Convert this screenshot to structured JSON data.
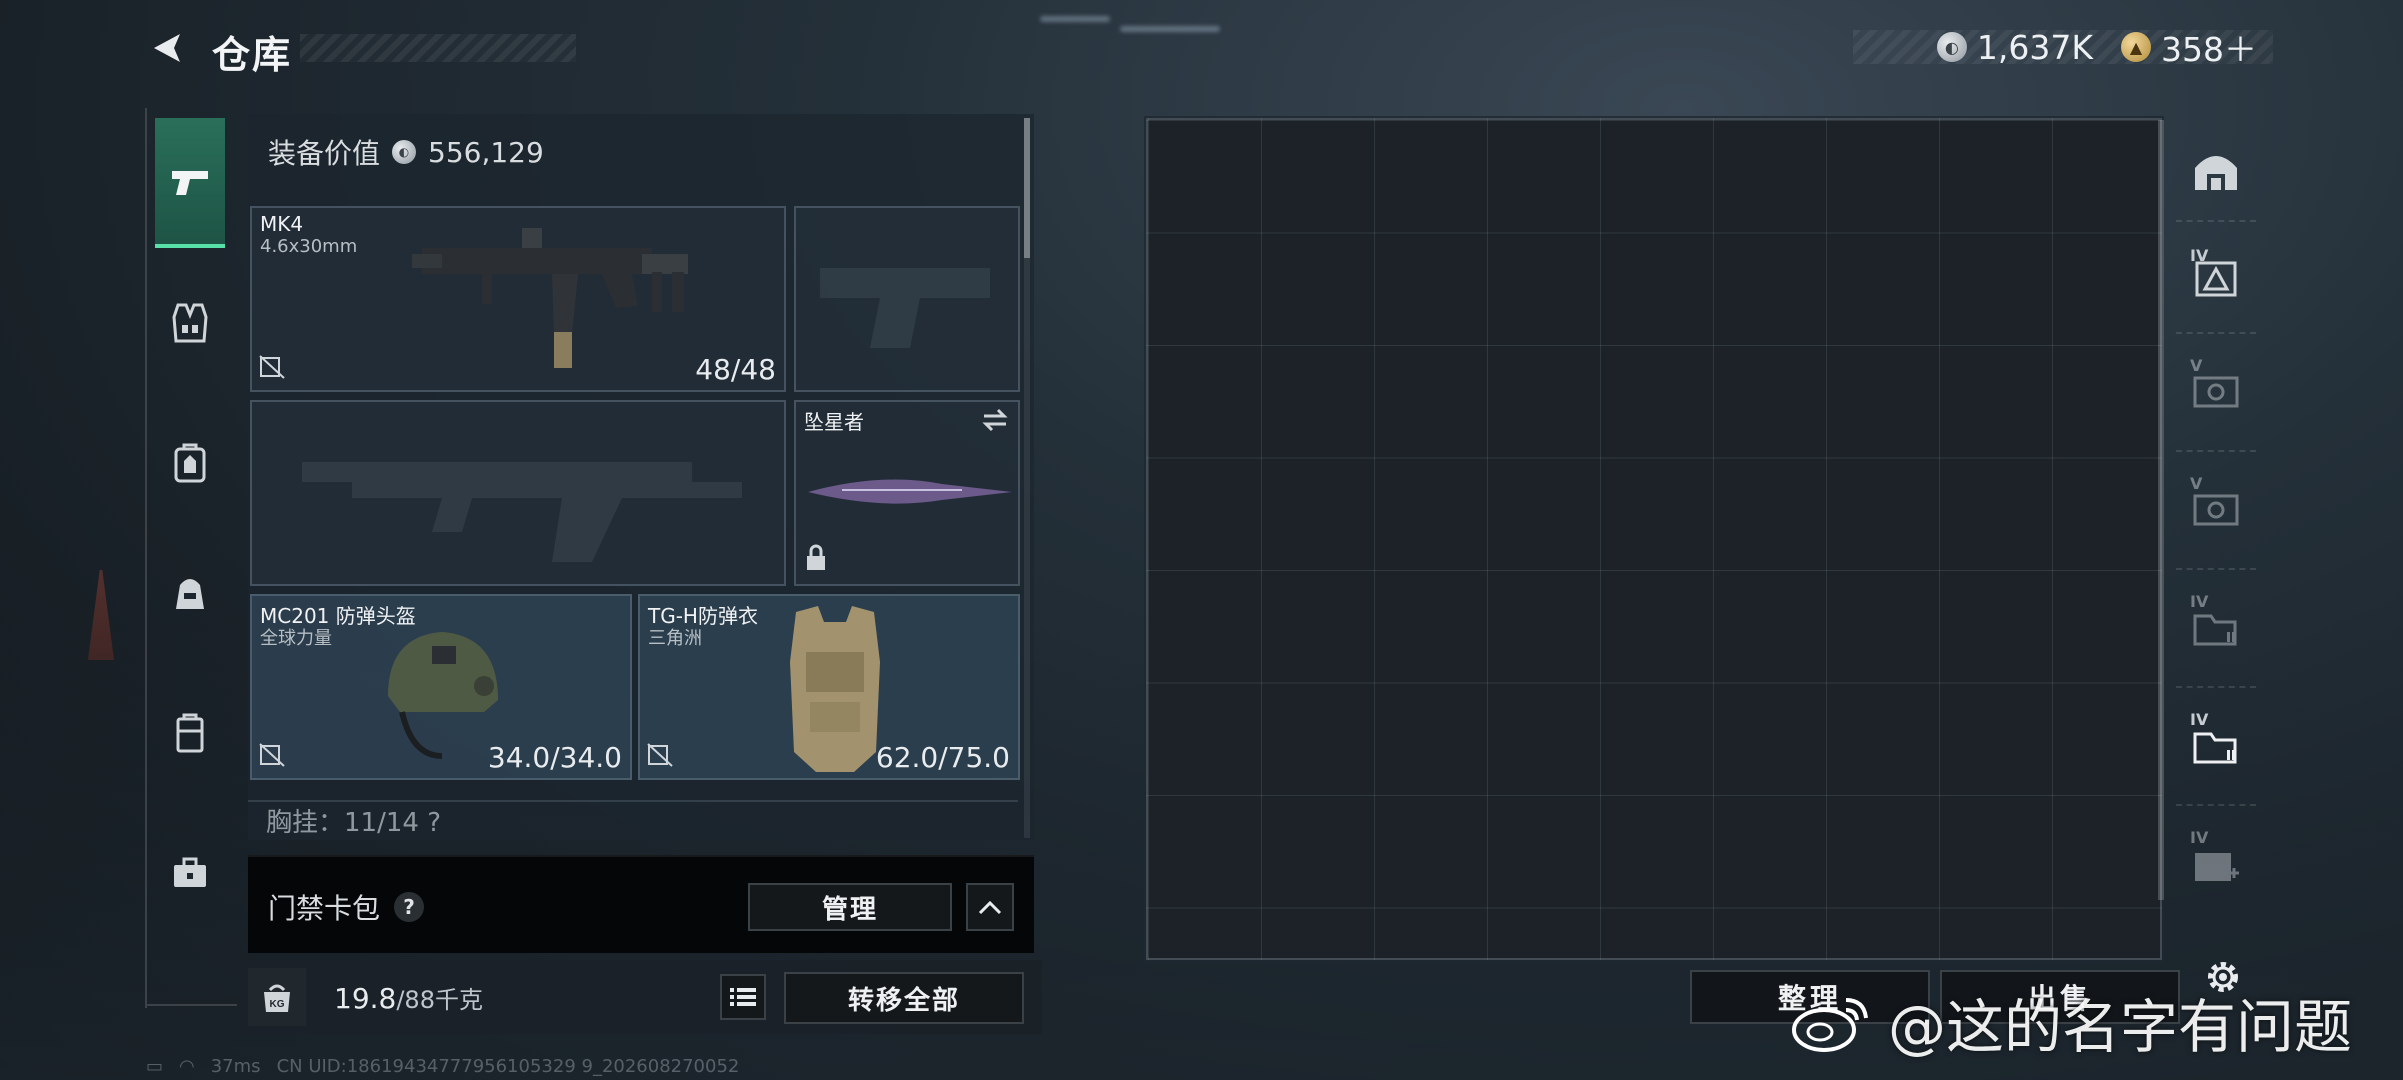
{
  "header": {
    "title": "仓库",
    "currencies": [
      {
        "icon": "silver-coin-icon",
        "value": "1,637K"
      },
      {
        "icon": "gold-coin-icon",
        "value": "358＋"
      }
    ]
  },
  "rail": {
    "items": [
      {
        "name": "weapons",
        "icon": "pistol-icon",
        "active": true
      },
      {
        "name": "chest-rig",
        "icon": "vest-icon"
      },
      {
        "name": "backpack",
        "icon": "backpack-icon"
      },
      {
        "name": "helmet-bag",
        "icon": "bag-icon"
      },
      {
        "name": "case",
        "icon": "container-icon"
      },
      {
        "name": "toolbox",
        "icon": "toolbox-icon"
      }
    ]
  },
  "loadout": {
    "value_label": "装备价值",
    "value": "556,129",
    "primary": {
      "name": "MK4",
      "caliber": "4.6x30mm",
      "ammo": "48/48"
    },
    "melee": {
      "name": "坠星者"
    },
    "helmet": {
      "name": "MC201 防弹头盔",
      "sub": "全球力量",
      "durability": "34.0/34.0"
    },
    "armor": {
      "name": "TG-H防弹衣",
      "sub": "三角洲",
      "durability": "62.0/75.0"
    },
    "chest_rig_partial": "胸挂：11/14  ?"
  },
  "keycard": {
    "label": "门禁卡包",
    "help": "?",
    "manage_label": "管理"
  },
  "bottom": {
    "weight_current": "19.8",
    "weight_max": "/88千克",
    "transfer_all_label": "转移全部"
  },
  "storage": {
    "sort_label": "整理",
    "sell_label": "出售"
  },
  "right_rail": {
    "tiers": [
      "",
      "IV",
      "V",
      "V",
      "IV",
      "IV",
      "IV"
    ]
  },
  "status": {
    "ping": "37ms",
    "uid": "CN UID:18619434777956105329 9_202608270052"
  },
  "watermark": {
    "text": "@这的名字有问题"
  },
  "colors": {
    "active_tab": "#2a6f5a",
    "active_underline": "#59e0a8",
    "panel": "#1c262e"
  }
}
